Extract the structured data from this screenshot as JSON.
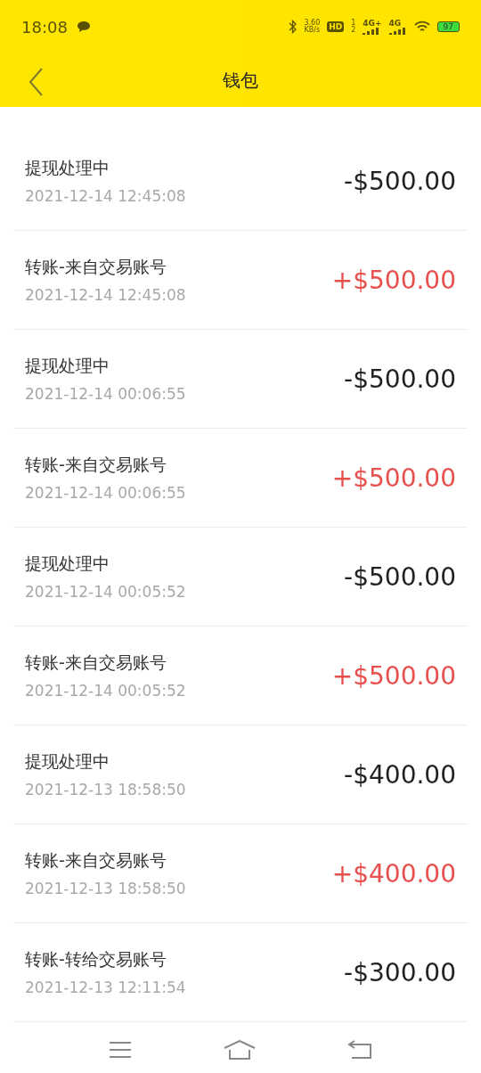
{
  "status_bar": {
    "time": "18:08",
    "speed_value": "3.60",
    "speed_unit": "KB/s",
    "hd": "HD",
    "hd_sims": [
      "1",
      "2"
    ],
    "networks": [
      "4G+",
      "4G"
    ],
    "battery": "97"
  },
  "header": {
    "title": "钱包"
  },
  "transactions": [
    {
      "title": "提现处理中",
      "date": "2021-12-14 12:45:08",
      "amount": "-$500.00",
      "kind": "debit"
    },
    {
      "title": "转账-来自交易账号",
      "date": "2021-12-14 12:45:08",
      "amount": "+$500.00",
      "kind": "credit"
    },
    {
      "title": "提现处理中",
      "date": "2021-12-14 00:06:55",
      "amount": "-$500.00",
      "kind": "debit"
    },
    {
      "title": "转账-来自交易账号",
      "date": "2021-12-14 00:06:55",
      "amount": "+$500.00",
      "kind": "credit"
    },
    {
      "title": "提现处理中",
      "date": "2021-12-14 00:05:52",
      "amount": "-$500.00",
      "kind": "debit"
    },
    {
      "title": "转账-来自交易账号",
      "date": "2021-12-14 00:05:52",
      "amount": "+$500.00",
      "kind": "credit"
    },
    {
      "title": "提现处理中",
      "date": "2021-12-13 18:58:50",
      "amount": "-$400.00",
      "kind": "debit"
    },
    {
      "title": "转账-来自交易账号",
      "date": "2021-12-13 18:58:50",
      "amount": "+$400.00",
      "kind": "credit"
    },
    {
      "title": "转账-转给交易账号",
      "date": "2021-12-13 12:11:54",
      "amount": "-$300.00",
      "kind": "debit"
    }
  ]
}
